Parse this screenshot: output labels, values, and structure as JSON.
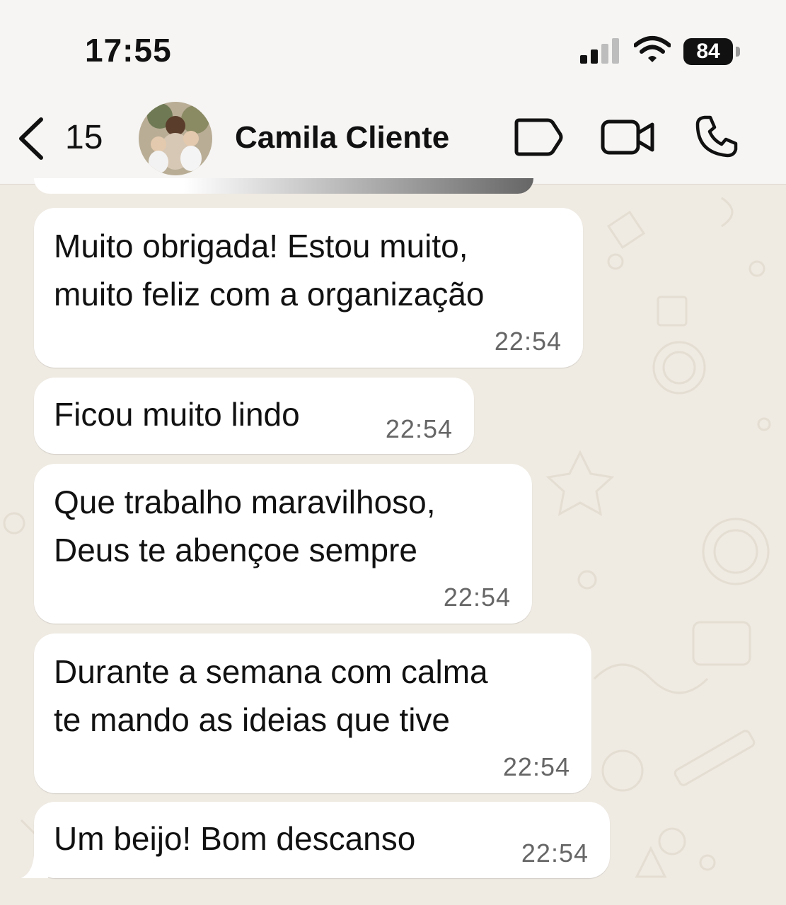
{
  "status_bar": {
    "time": "17:55",
    "battery": "84"
  },
  "header": {
    "back_count": "15",
    "contact_name": "Camila Cliente"
  },
  "messages": [
    {
      "text": "Muito obrigada! Estou muito,\nmuito feliz com a organização",
      "time": "22:54"
    },
    {
      "text": "Ficou muito lindo",
      "time": "22:54"
    },
    {
      "text": "Que trabalho maravilhoso,\nDeus te abençoe sempre",
      "time": "22:54"
    },
    {
      "text": "Durante a semana com calma\nte mando as ideias que tive",
      "time": "22:54"
    },
    {
      "text": "Um beijo! Bom descanso",
      "time": "22:54"
    }
  ],
  "colors": {
    "wallpaper": "#efeae2",
    "bubble": "#ffffff",
    "header": "#f6f5f3"
  },
  "icons": [
    "back-chevron-icon",
    "label-tag-icon",
    "video-call-icon",
    "phone-icon",
    "signal-icon",
    "wifi-icon",
    "battery-icon"
  ]
}
